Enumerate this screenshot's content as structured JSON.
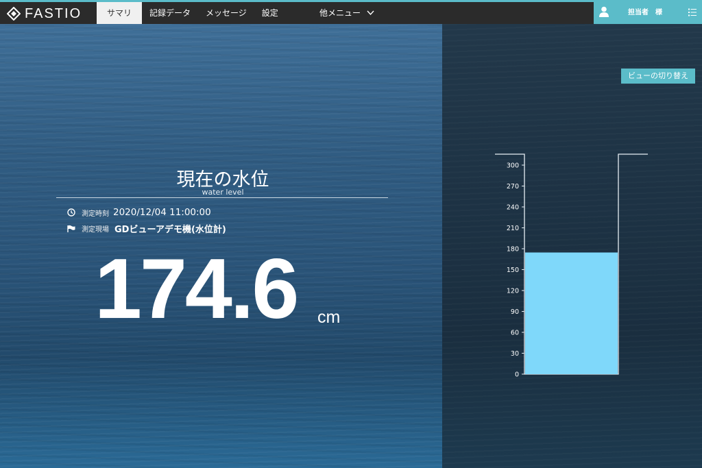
{
  "header": {
    "logo_text": "FASTIO",
    "nav_items": [
      "サマリー",
      "記録データ",
      "メッセージ",
      "設定"
    ],
    "other_menu": "他メニュー",
    "user_label": "担当者　様"
  },
  "view_toggle_label": "ビューの切り替え",
  "summary": {
    "title": "現在の水位",
    "subtitle": "water level",
    "time_label": "測定時刻",
    "time_value": "2020/12/04 11:00:00",
    "site_label": "測定現場",
    "site_value": "GDビューアデモ機(水位計)",
    "value": "174.6",
    "unit": "cm"
  },
  "chart_data": {
    "type": "bar",
    "categories": [
      ""
    ],
    "values": [
      174.6
    ],
    "ylim": [
      0,
      300
    ],
    "yticks": [
      0,
      30,
      60,
      90,
      120,
      150,
      180,
      210,
      240,
      270,
      300
    ],
    "bar_color": "#7fd8fa"
  },
  "colors": {
    "accent": "#5bbcc9",
    "topbar": "#2b2b2b"
  },
  "icons": {
    "logo": "diamond-logo-icon",
    "menu_dropdown": "chevron-down-icon",
    "user": "user-icon",
    "list": "list-icon",
    "time": "clock-icon",
    "site": "flag-icon"
  }
}
